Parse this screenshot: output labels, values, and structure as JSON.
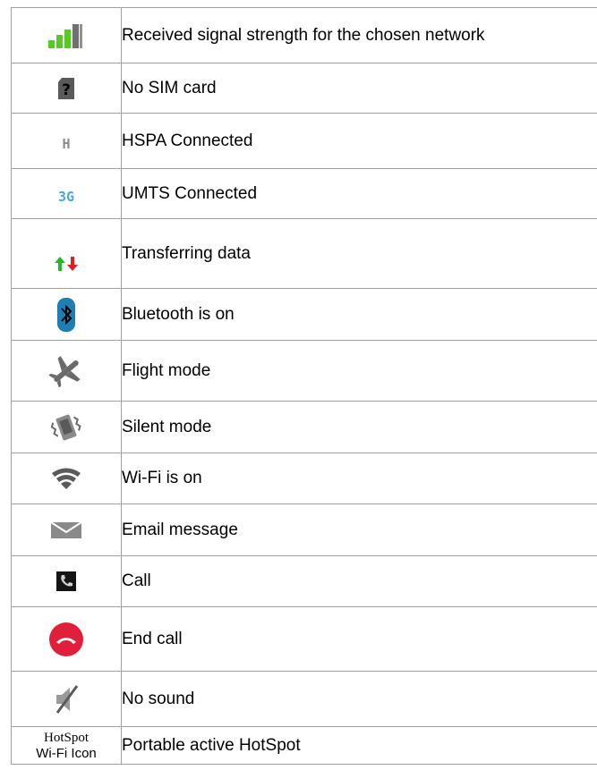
{
  "colors": {
    "signal_green": "#55cc22",
    "signal_grey": "#707070",
    "arrow_up": "#22bb22",
    "arrow_down": "#e02020",
    "bluetooth_bg": "#1e7fb3",
    "end_call_red": "#e0203a",
    "border": "#a0a0a0"
  },
  "rows": [
    {
      "icon": "signal-strength-icon",
      "label": "Received signal strength for the chosen network"
    },
    {
      "icon": "no-sim-card-icon",
      "label": "No SIM card"
    },
    {
      "icon": "hspa-icon",
      "icon_text": "H",
      "label": "HSPA Connected"
    },
    {
      "icon": "umts-3g-icon",
      "icon_text": "3G",
      "label": "UMTS Connected"
    },
    {
      "icon": "data-transfer-arrows-icon",
      "label": "Transferring data"
    },
    {
      "icon": "bluetooth-icon",
      "label": "Bluetooth is on"
    },
    {
      "icon": "airplane-icon",
      "label": "Flight mode"
    },
    {
      "icon": "vibrate-phone-icon",
      "label": "Silent mode"
    },
    {
      "icon": "wifi-icon",
      "label": "Wi-Fi is on"
    },
    {
      "icon": "envelope-icon",
      "label": "Email message"
    },
    {
      "icon": "phone-handset-icon",
      "label": "Call"
    },
    {
      "icon": "end-call-icon",
      "label": "End call"
    },
    {
      "icon": "muted-speaker-icon",
      "label": "No sound"
    },
    {
      "icon": "hotspot-text",
      "icon_text_line1": "HotSpot",
      "icon_text_line2": "Wi-Fi Icon",
      "label": "Portable active HotSpot"
    }
  ]
}
